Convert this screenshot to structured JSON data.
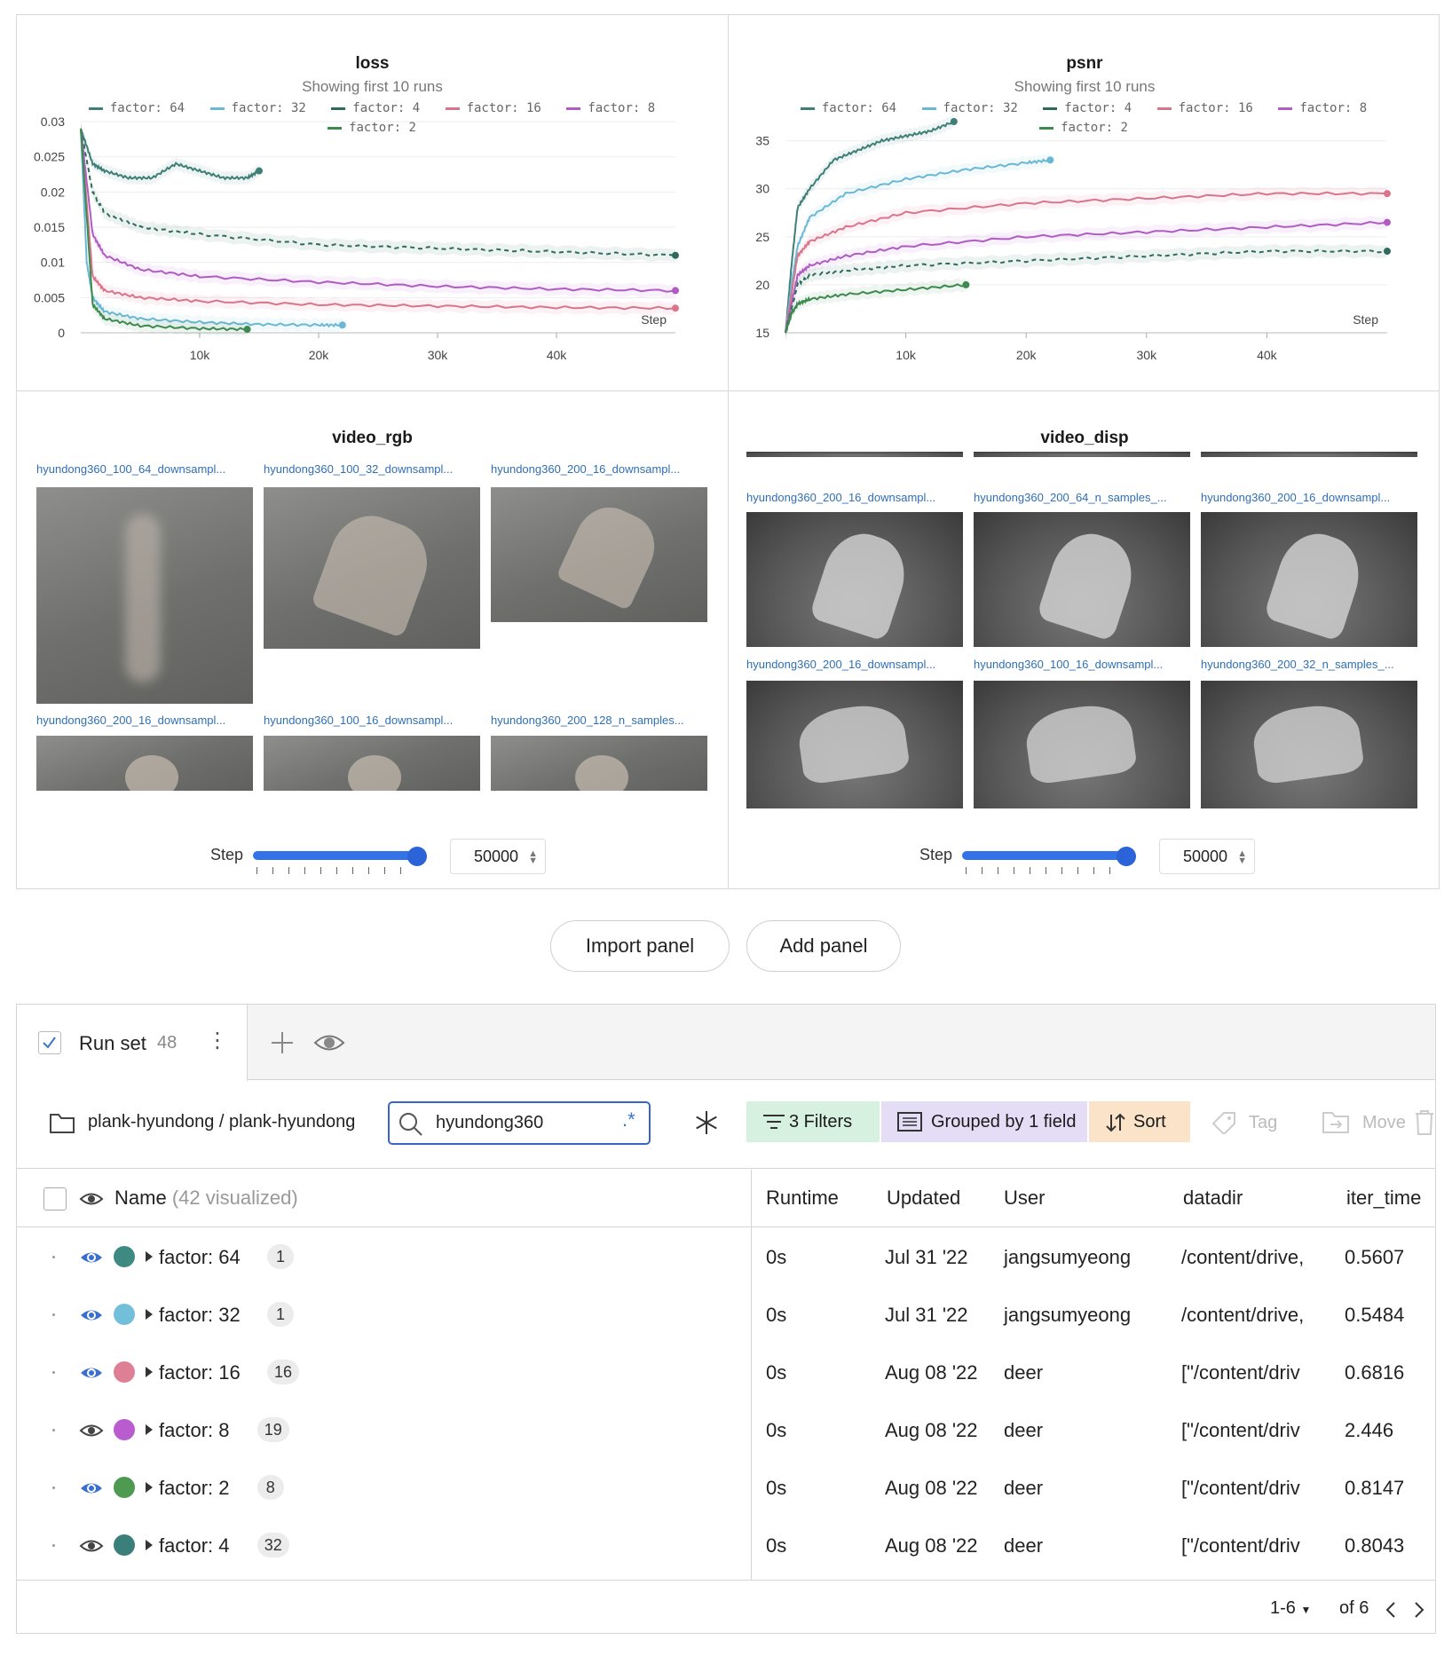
{
  "charts": {
    "loss": {
      "title": "loss",
      "subtitle": "Showing first 10 runs",
      "y_ticks": [
        "0.03",
        "0.025",
        "0.02",
        "0.015",
        "0.01",
        "0.005",
        "0"
      ],
      "x_ticks": [
        "10k",
        "20k",
        "30k",
        "40k"
      ],
      "x_axis_label": "Step"
    },
    "psnr": {
      "title": "psnr",
      "subtitle": "Showing first 10 runs",
      "y_ticks": [
        "35",
        "30",
        "25",
        "20",
        "15"
      ],
      "x_ticks": [
        "10k",
        "20k",
        "30k",
        "40k"
      ],
      "x_axis_label": "Step"
    },
    "legend": [
      {
        "label": "factor: 64",
        "color": "#3e7f78"
      },
      {
        "label": "factor: 32",
        "color": "#6bb8d4"
      },
      {
        "label": "factor: 4",
        "color": "#2e6b5e"
      },
      {
        "label": "factor: 16",
        "color": "#d9748b"
      },
      {
        "label": "factor: 8",
        "color": "#b05cc3"
      },
      {
        "label": "factor: 2",
        "color": "#3d8a4e"
      }
    ]
  },
  "chart_data": [
    {
      "type": "line",
      "title": "loss",
      "xlabel": "Step",
      "xlim": [
        0,
        50000
      ],
      "ylim": [
        0,
        0.03
      ],
      "series": [
        {
          "name": "factor: 64",
          "x": [
            0,
            1000,
            2000,
            4000,
            6000,
            8000,
            10000,
            12000,
            14000,
            15000
          ],
          "y": [
            0.029,
            0.024,
            0.023,
            0.022,
            0.022,
            0.024,
            0.023,
            0.022,
            0.022,
            0.023
          ]
        },
        {
          "name": "factor: 32",
          "x": [
            0,
            500,
            1000,
            2000,
            5000,
            10000,
            15000,
            20000,
            22000
          ],
          "y": [
            0.029,
            0.01,
            0.005,
            0.003,
            0.002,
            0.0015,
            0.0012,
            0.0011,
            0.0011
          ]
        },
        {
          "name": "factor: 4",
          "x": [
            0,
            1000,
            2000,
            5000,
            10000,
            20000,
            30000,
            40000,
            50000
          ],
          "y": [
            0.029,
            0.02,
            0.017,
            0.015,
            0.014,
            0.0125,
            0.012,
            0.0115,
            0.011
          ]
        },
        {
          "name": "factor: 16",
          "x": [
            0,
            1000,
            2000,
            5000,
            10000,
            20000,
            30000,
            40000,
            50000
          ],
          "y": [
            0.029,
            0.008,
            0.006,
            0.005,
            0.0045,
            0.004,
            0.0038,
            0.0036,
            0.0035
          ]
        },
        {
          "name": "factor: 8",
          "x": [
            0,
            1000,
            2000,
            5000,
            10000,
            20000,
            30000,
            40000,
            50000
          ],
          "y": [
            0.029,
            0.014,
            0.011,
            0.009,
            0.008,
            0.0072,
            0.0066,
            0.0062,
            0.006
          ]
        },
        {
          "name": "factor: 2",
          "x": [
            0,
            1000,
            2000,
            5000,
            10000,
            14000
          ],
          "y": [
            0.029,
            0.004,
            0.002,
            0.001,
            0.0006,
            0.0005
          ]
        }
      ]
    },
    {
      "type": "line",
      "title": "psnr",
      "xlabel": "Step",
      "xlim": [
        0,
        50000
      ],
      "ylim": [
        15,
        37
      ],
      "series": [
        {
          "name": "factor: 64",
          "x": [
            0,
            500,
            1000,
            2000,
            4000,
            6000,
            8000,
            10000,
            12000,
            14000
          ],
          "y": [
            15,
            22,
            28,
            30,
            33,
            34,
            35,
            35.5,
            36,
            37
          ]
        },
        {
          "name": "factor: 32",
          "x": [
            0,
            500,
            1000,
            2000,
            5000,
            10000,
            15000,
            20000,
            22000
          ],
          "y": [
            15,
            20,
            24,
            27,
            29.5,
            31,
            32,
            32.7,
            33
          ]
        },
        {
          "name": "factor: 16",
          "x": [
            0,
            1000,
            2000,
            5000,
            10000,
            20000,
            30000,
            40000,
            50000
          ],
          "y": [
            15,
            23,
            24.5,
            26,
            27.5,
            28.5,
            29,
            29.5,
            29.5
          ]
        },
        {
          "name": "factor: 8",
          "x": [
            0,
            1000,
            2000,
            5000,
            10000,
            20000,
            30000,
            40000,
            50000
          ],
          "y": [
            15,
            21,
            22,
            23,
            24,
            25,
            25.5,
            26,
            26.5
          ]
        },
        {
          "name": "factor: 4",
          "x": [
            0,
            1000,
            2000,
            5000,
            10000,
            20000,
            30000,
            40000,
            50000
          ],
          "y": [
            15,
            20,
            21,
            21.5,
            22,
            22.5,
            23,
            23.5,
            23.5
          ]
        },
        {
          "name": "factor: 2",
          "x": [
            0,
            500,
            1000,
            2000,
            5000,
            10000,
            15000
          ],
          "y": [
            15,
            17,
            18,
            18.5,
            19,
            19.5,
            20
          ]
        }
      ]
    }
  ],
  "media": {
    "rgb": {
      "title": "video_rgb",
      "labels": [
        "hyundong360_100_64_downsampl...",
        "hyundong360_100_32_downsampl...",
        "hyundong360_200_16_downsampl...",
        "hyundong360_200_16_downsampl...",
        "hyundong360_100_16_downsampl...",
        "hyundong360_200_128_n_samples..."
      ],
      "step_label": "Step",
      "step_value": "50000",
      "slider_fraction": 1.0
    },
    "disp": {
      "title": "video_disp",
      "labels": [
        "hyundong360_200_16_downsampl...",
        "hyundong360_200_64_n_samples_...",
        "hyundong360_200_16_downsampl...",
        "hyundong360_200_16_downsampl...",
        "hyundong360_100_16_downsampl...",
        "hyundong360_200_32_n_samples_..."
      ],
      "step_label": "Step",
      "step_value": "50000",
      "slider_fraction": 1.0
    }
  },
  "buttons": {
    "import_panel": "Import panel",
    "add_panel": "Add panel"
  },
  "runset": {
    "tab_label": "Run set",
    "tab_count": "48",
    "project": "plank-hyundong / plank-hyundong",
    "search_value": "hyundong360",
    "regex_glyph": ".*",
    "filters": "3 Filters",
    "grouped": "Grouped by 1 field",
    "sort": "Sort",
    "tag": "Tag",
    "move": "Move",
    "name_header": "Name",
    "visualized": "(42 visualized)",
    "columns": [
      "Runtime",
      "Updated",
      "User",
      "datadir",
      "iter_time"
    ],
    "rows": [
      {
        "name": "factor: 64",
        "count": "1",
        "visible": true,
        "color": "#3e8a82",
        "runtime": "0s",
        "updated": "Jul 31 '22",
        "user": "jangsumyeong",
        "datadir": "/content/drive,",
        "iter_time": "0.5607"
      },
      {
        "name": "factor: 32",
        "count": "1",
        "visible": true,
        "color": "#72bfd9",
        "runtime": "0s",
        "updated": "Jul 31 '22",
        "user": "jangsumyeong",
        "datadir": "/content/drive,",
        "iter_time": "0.5484"
      },
      {
        "name": "factor: 16",
        "count": "16",
        "visible": true,
        "color": "#df7f96",
        "runtime": "0s",
        "updated": "Aug 08 '22",
        "user": "deer",
        "datadir": "[\"/content/driv",
        "iter_time": "0.6816"
      },
      {
        "name": "factor: 8",
        "count": "19",
        "visible": false,
        "color": "#b95ccf",
        "runtime": "0s",
        "updated": "Aug 08 '22",
        "user": "deer",
        "datadir": "[\"/content/driv",
        "iter_time": "2.446"
      },
      {
        "name": "factor: 2",
        "count": "8",
        "visible": true,
        "color": "#4f9a52",
        "runtime": "0s",
        "updated": "Aug 08 '22",
        "user": "deer",
        "datadir": "[\"/content/driv",
        "iter_time": "0.8147"
      },
      {
        "name": "factor: 4",
        "count": "32",
        "visible": false,
        "color": "#3a7f7a",
        "runtime": "0s",
        "updated": "Aug 08 '22",
        "user": "deer",
        "datadir": "[\"/content/driv",
        "iter_time": "0.8043"
      }
    ],
    "pagination": {
      "range": "1-6",
      "of": "of 6"
    }
  }
}
